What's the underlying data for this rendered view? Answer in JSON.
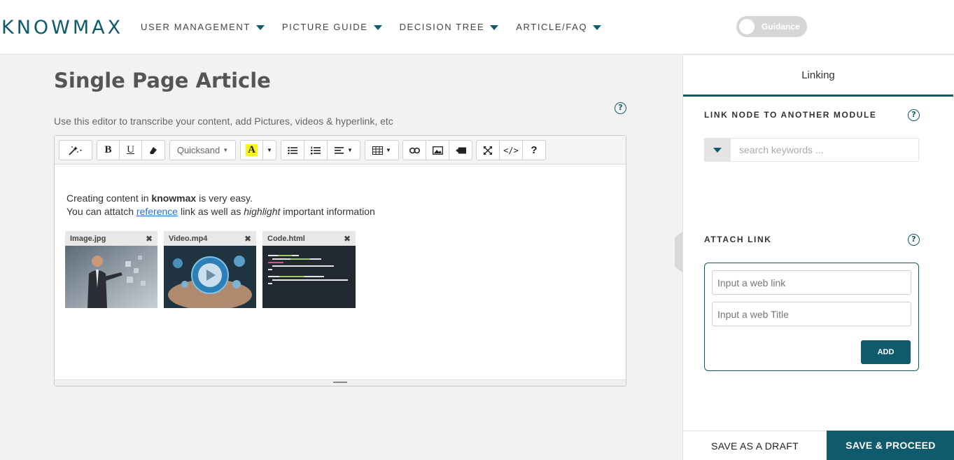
{
  "brand": {
    "logo_text": "KNOWMAX",
    "accent": "#0f5a6c"
  },
  "nav": {
    "items": [
      {
        "label": "USER MANAGEMENT"
      },
      {
        "label": "PICTURE GUIDE"
      },
      {
        "label": "DECISION TREE"
      },
      {
        "label": "ARTICLE/FAQ"
      }
    ],
    "guidance_label": "Guidance"
  },
  "main": {
    "title": "Single Page Article",
    "subtitle": "Use this editor to transcribe your content, add Pictures, videos & hyperlink, etc",
    "help_glyph": "?"
  },
  "editor": {
    "toolbar": {
      "font_name": "Quicksand",
      "highlight_letter": "A",
      "bold": "B",
      "underline": "U",
      "code": "</>",
      "help": "?"
    },
    "content": {
      "line1_prefix": "Creating content in ",
      "line1_bold": "knowmax",
      "line1_suffix": " is very easy.",
      "line2_prefix": "You can attatch ",
      "line2_link": "reference",
      "line2_mid": " link as well as ",
      "line2_italic": "highlight",
      "line2_suffix": " important information"
    },
    "attachments": [
      {
        "name": "Image.jpg",
        "close": "✖"
      },
      {
        "name": "Video.mp4",
        "close": "✖"
      },
      {
        "name": "Code.html",
        "close": "✖"
      }
    ]
  },
  "panel": {
    "tab_label": "Linking",
    "link_node_label": "LINK NODE TO ANOTHER MODULE",
    "search_placeholder": "search keywords ...",
    "attach_link_label": "ATTACH LINK",
    "web_link_placeholder": "Input a web link",
    "web_title_placeholder": "Input a web Title",
    "add_label": "ADD",
    "help_glyph": "?"
  },
  "footer": {
    "draft_label": "SAVE AS A DRAFT",
    "proceed_label": "SAVE & PROCEED"
  }
}
